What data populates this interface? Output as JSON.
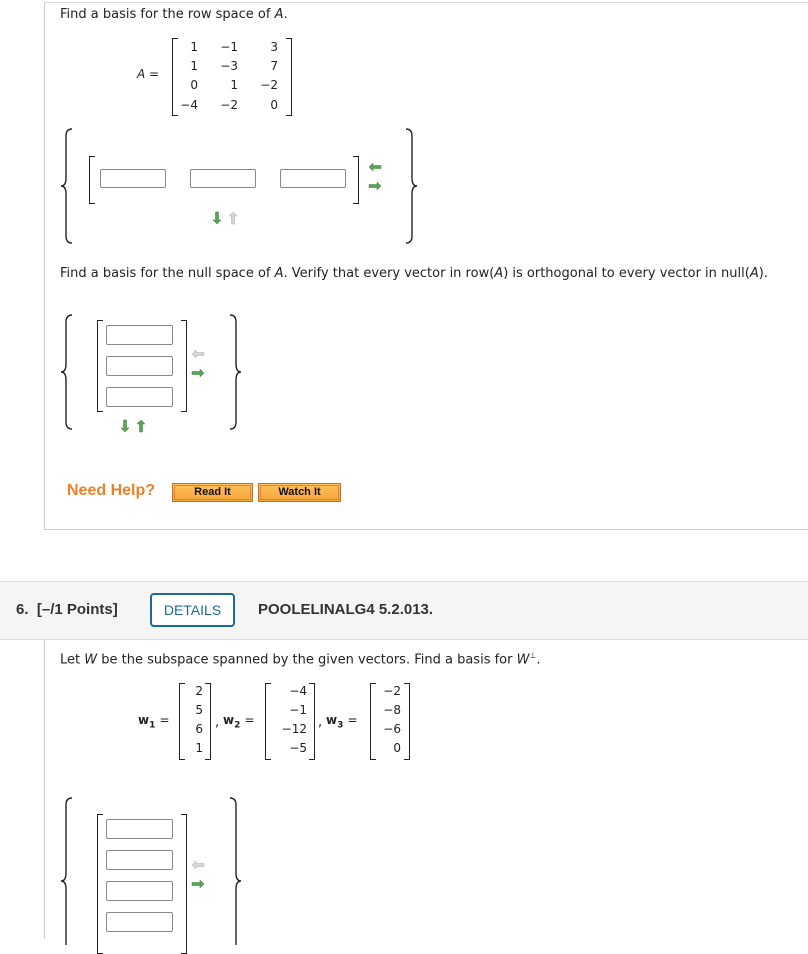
{
  "question5": {
    "part1": {
      "prompt_pre": "Find a basis for the row space of ",
      "prompt_var": "A",
      "prompt_post": ".",
      "matrix_label": "A =",
      "matrix": [
        [
          "1",
          "−1",
          "3"
        ],
        [
          "1",
          "−3",
          "7"
        ],
        [
          "0",
          "1",
          "−2"
        ],
        [
          "−4",
          "−2",
          "0"
        ]
      ],
      "answer_inputs": [
        "",
        "",
        ""
      ],
      "controls": {
        "remove_column_icon": "arrow-left-icon",
        "add_column_icon": "arrow-right-icon",
        "add_vector_icon": "arrow-down-icon",
        "remove_vector_icon": "arrow-up-icon",
        "remove_column_enabled": true,
        "remove_vector_enabled": false
      }
    },
    "part2": {
      "prompt_a": "Find a basis for the null space of ",
      "prompt_b": "A",
      "prompt_c": ". Verify that every vector in row(",
      "prompt_d": "A",
      "prompt_e": ") is orthogonal to every vector in null(",
      "prompt_f": "A",
      "prompt_g": ").",
      "answer_inputs": [
        "",
        "",
        ""
      ],
      "controls": {
        "remove_row_enabled": false,
        "remove_vector_enabled": true
      }
    },
    "help": {
      "label": "Need Help?",
      "read_it": "Read It",
      "watch_it": "Watch It"
    }
  },
  "question6": {
    "number": "6.",
    "points": "[–/1 Points]",
    "details_button": "DETAILS",
    "reference": "POOLELINALG4 5.2.013.",
    "prompt_a": "Let ",
    "prompt_w": "W",
    "prompt_b": " be the subspace spanned by the given vectors. Find a basis for ",
    "prompt_w2": "W",
    "prompt_perp": "⊥",
    "prompt_c": ".",
    "vectors": [
      {
        "name": "w",
        "sub": "1",
        "values": [
          "2",
          "5",
          "6",
          "1"
        ]
      },
      {
        "name": "w",
        "sub": "2",
        "values": [
          "−4",
          "−1",
          "−12",
          "−5"
        ]
      },
      {
        "name": "w",
        "sub": "3",
        "values": [
          "−2",
          "−8",
          "−6",
          "0"
        ]
      }
    ],
    "eq": "=",
    "comma": ",",
    "answer_inputs": [
      "",
      "",
      "",
      ""
    ],
    "controls": {
      "remove_row_enabled": false
    }
  },
  "colors": {
    "accent": "#1d6a96",
    "help": "#e9822b",
    "arrow_active": "#5aa35a",
    "arrow_disabled": "#c8c8c8"
  }
}
